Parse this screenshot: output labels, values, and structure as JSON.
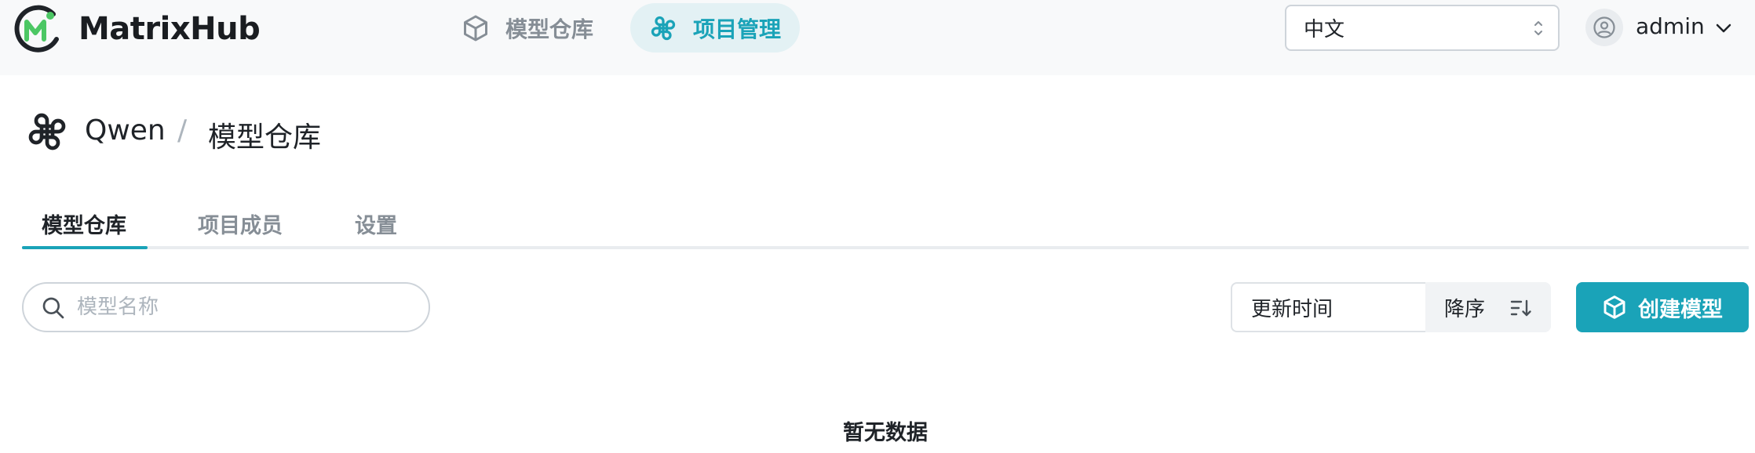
{
  "brand": {
    "name": "MatrixHub",
    "colors": {
      "accent": "#1aa3b8",
      "logo_green": "#4cc764",
      "logo_dark": "#1f2328"
    }
  },
  "top_nav": {
    "items": [
      {
        "label": "模型仓库",
        "icon": "cube-icon",
        "active": false
      },
      {
        "label": "项目管理",
        "icon": "project-icon",
        "active": true
      }
    ]
  },
  "language": {
    "selected": "中文"
  },
  "user": {
    "name": "admin"
  },
  "breadcrumb": {
    "project": "Qwen",
    "separator": "/",
    "page": "模型仓库"
  },
  "tabs": [
    {
      "label": "模型仓库",
      "active": true
    },
    {
      "label": "项目成员",
      "active": false
    },
    {
      "label": "设置",
      "active": false
    }
  ],
  "toolbar": {
    "search_placeholder": "模型名称",
    "sort_field": "更新时间",
    "sort_order": "降序",
    "create_label": "创建模型"
  },
  "empty_state": {
    "message": "暂无数据"
  }
}
